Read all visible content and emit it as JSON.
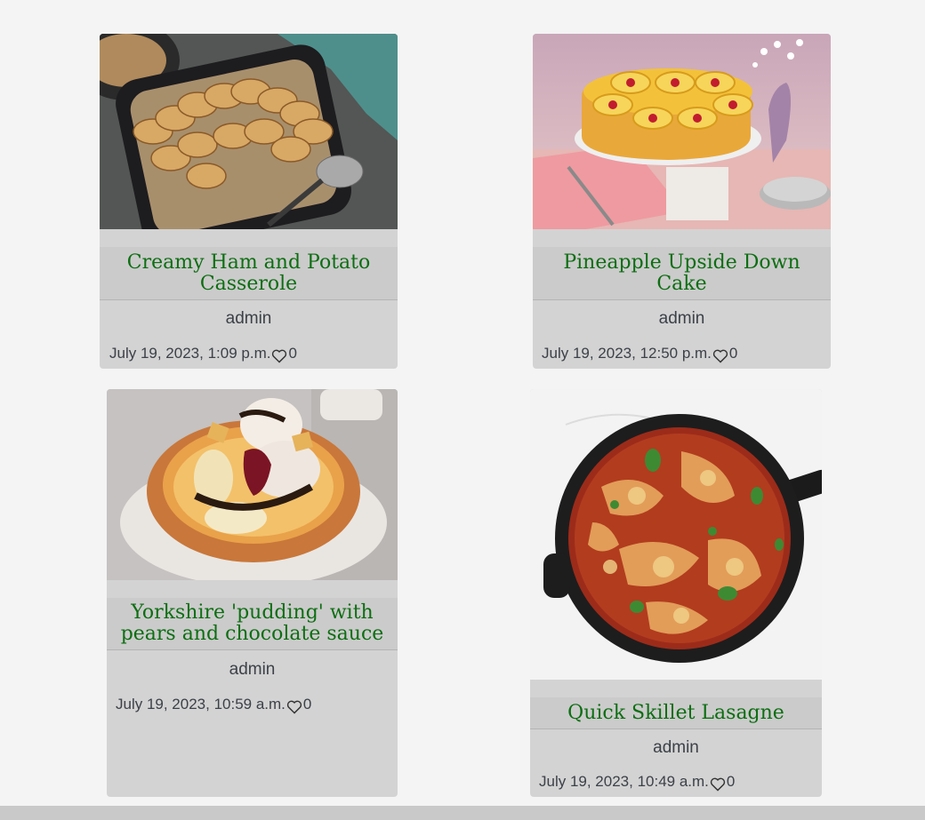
{
  "posts": [
    {
      "title": "Creamy Ham and Potato Casserole",
      "author": "admin",
      "date": "July 19, 2023, 1:09 p.m.",
      "likes": "0",
      "image_icon": "casserole-image"
    },
    {
      "title": "Pineapple Upside Down Cake",
      "author": "admin",
      "date": "July 19, 2023, 12:50 p.m.",
      "likes": "0",
      "image_icon": "cake-image"
    },
    {
      "title": "Yorkshire 'pudding' with pears and chocolate sauce",
      "author": "admin",
      "date": "July 19, 2023, 10:59 a.m.",
      "likes": "0",
      "image_icon": "pudding-image"
    },
    {
      "title": "Quick Skillet Lasagne",
      "author": "admin",
      "date": "July 19, 2023, 10:49 a.m.",
      "likes": "0",
      "image_icon": "lasagne-image"
    }
  ],
  "colors": {
    "page_bg": "#f4f4f4",
    "card_bg": "#d3d3d3",
    "title_color": "#0d6e12",
    "text_color": "#3c4148"
  }
}
